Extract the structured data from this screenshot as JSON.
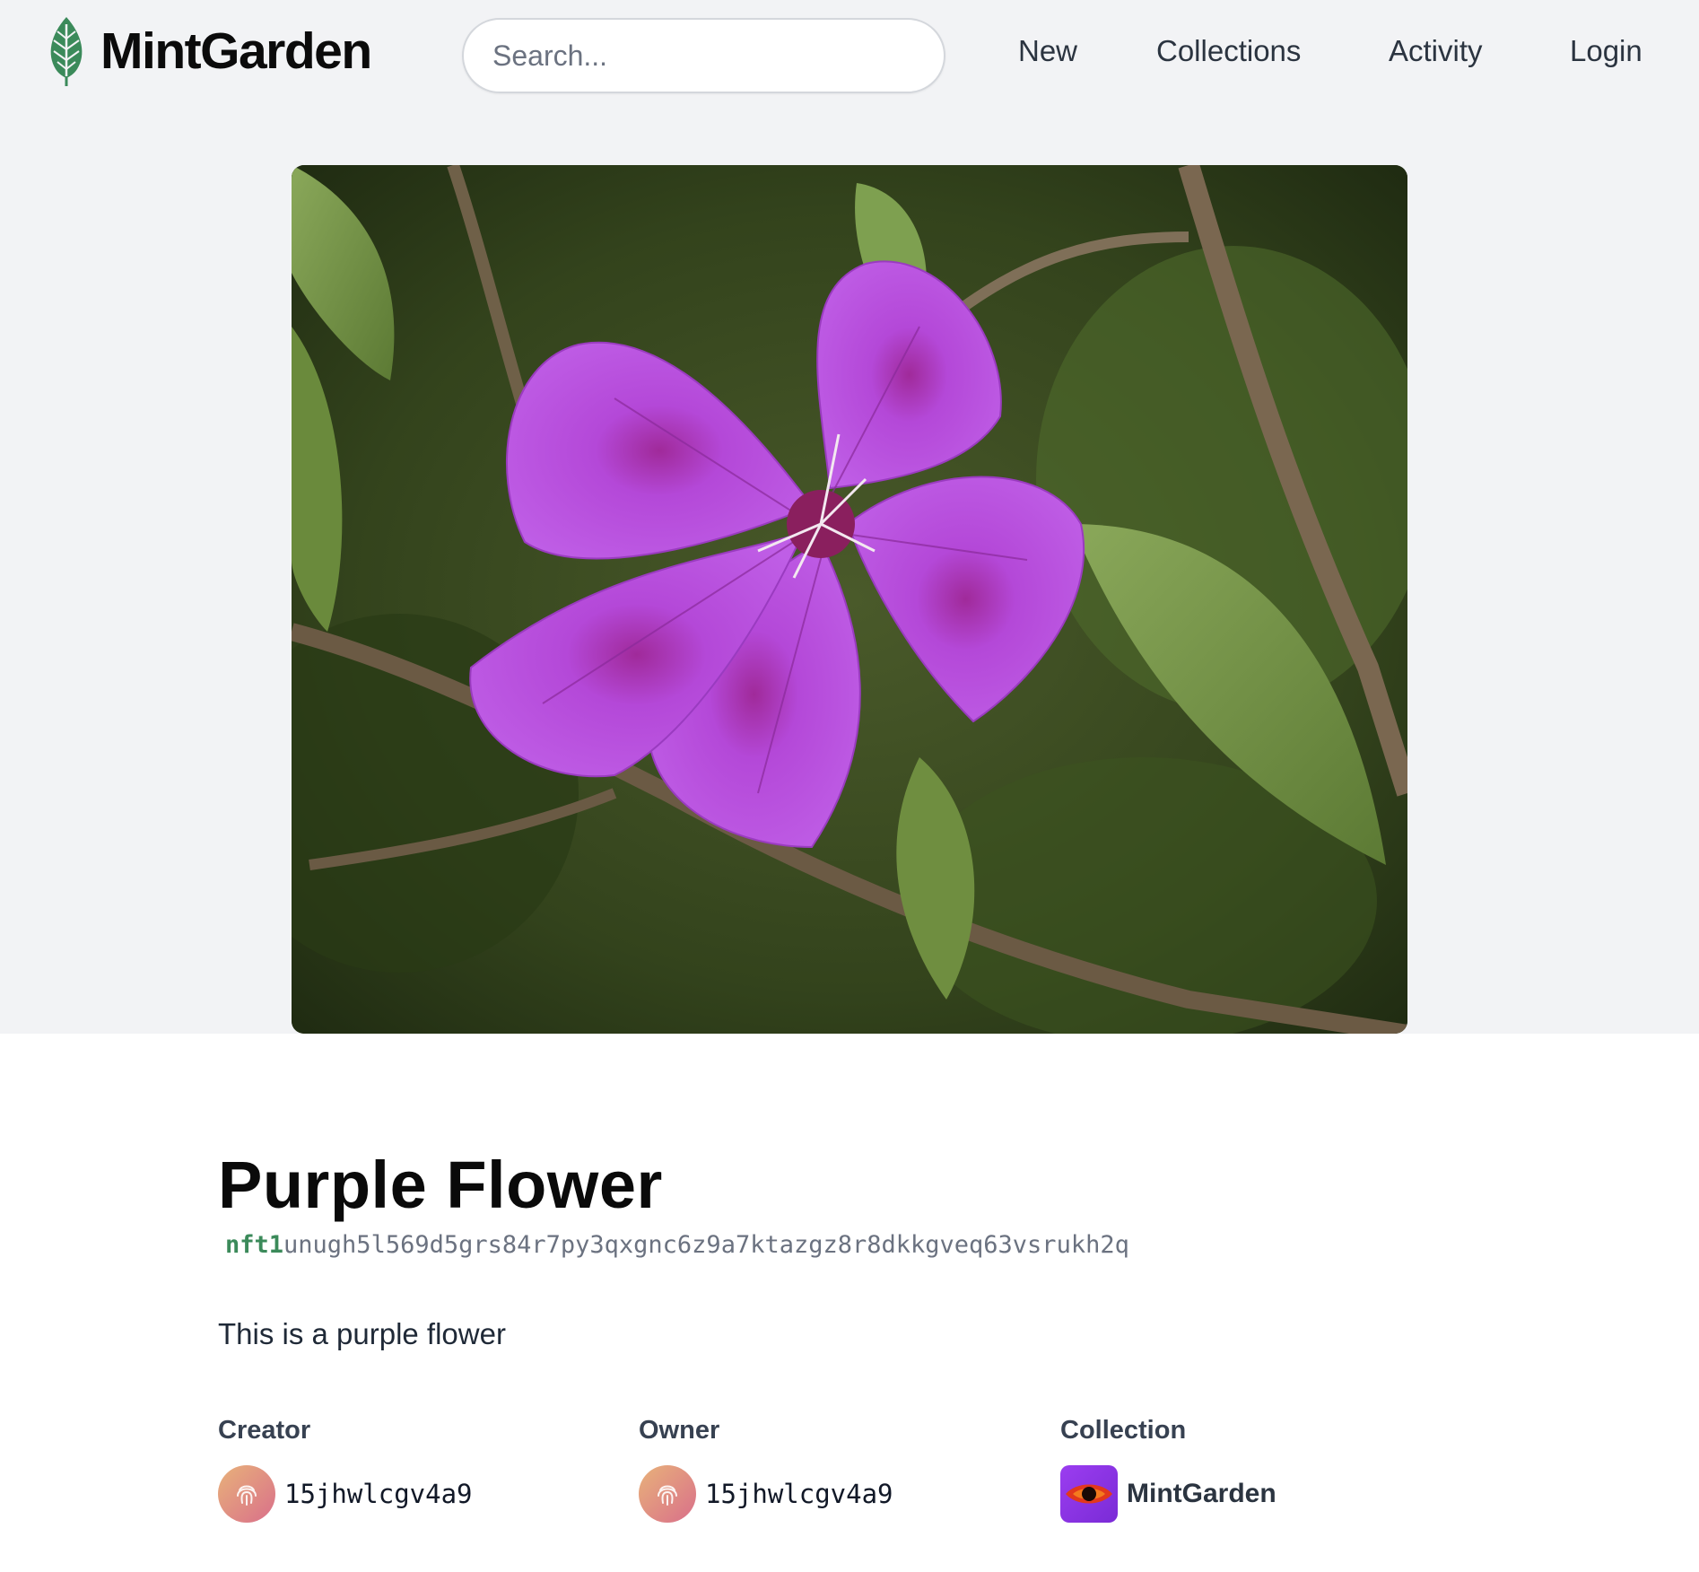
{
  "header": {
    "logo_text": "MintGarden",
    "search_placeholder": "Search...",
    "nav": {
      "new": "New",
      "collections": "Collections",
      "activity": "Activity",
      "login": "Login"
    }
  },
  "nft": {
    "image_alt": "Purple flower",
    "title": "Purple Flower",
    "id_prefix": "nft1",
    "id_rest": "unugh5l569d5grs84r7py3qxgnc6z9a7ktazgz8r8dkkgveq63vsrukh2q",
    "description": "This is a purple flower"
  },
  "details": {
    "creator": {
      "label": "Creator",
      "value": "15jhwlcgv4a9",
      "icon": "fingerprint-icon"
    },
    "owner": {
      "label": "Owner",
      "value": "15jhwlcgv4a9",
      "icon": "fingerprint-icon"
    },
    "collection": {
      "label": "Collection",
      "value": "MintGarden",
      "icon": "eye-icon"
    }
  },
  "colors": {
    "brand_green": "#3b8a5a",
    "page_band": "#f2f3f5",
    "collection_purple": "#8a35e6"
  }
}
